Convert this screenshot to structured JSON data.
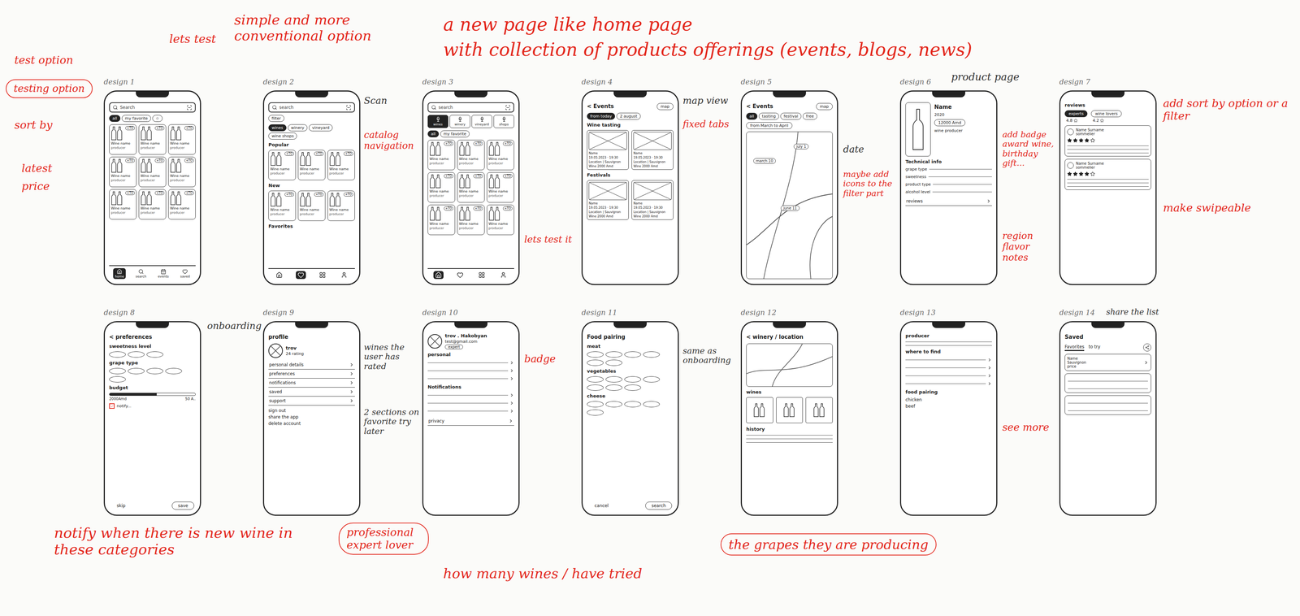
{
  "annotations": [
    {
      "text": "a new page like home page",
      "color": "#e3261b",
      "circled": false
    },
    {
      "text": "with collection of products offerings (events, blogs, news)",
      "color": "#e3261b",
      "circled": false
    },
    {
      "text": "lets test",
      "color": "#e3261b",
      "circled": false
    },
    {
      "text": "simple and more conventional option",
      "color": "#e3261b",
      "circled": false
    },
    {
      "text": "test option",
      "color": "#e3261b",
      "circled": false
    },
    {
      "text": "testing option",
      "color": "#e3261b",
      "circled": true
    },
    {
      "text": "sort by",
      "color": "#e3261b",
      "circled": false
    },
    {
      "text": "latest",
      "color": "#e3261b",
      "circled": false
    },
    {
      "text": "price",
      "color": "#e3261b",
      "circled": false
    },
    {
      "text": "Scan",
      "color": "#333333",
      "circled": false
    },
    {
      "text": "catalog navigation",
      "color": "#e3261b",
      "circled": false
    },
    {
      "text": "lets test it",
      "color": "#e3261b",
      "circled": false
    },
    {
      "text": "map view",
      "color": "#333333",
      "circled": false
    },
    {
      "text": "fixed tabs",
      "color": "#e3261b",
      "circled": false
    },
    {
      "text": "date",
      "color": "#333333",
      "circled": false
    },
    {
      "text": "maybe add icons to the filter part",
      "color": "#e3261b",
      "circled": false
    },
    {
      "text": "product page",
      "color": "#333333",
      "circled": false
    },
    {
      "text": "add badge award wine, birthday gift...",
      "color": "#e3261b",
      "circled": false
    },
    {
      "text": "region flavor notes",
      "color": "#e3261b",
      "circled": false
    },
    {
      "text": "add sort by option or a filter",
      "color": "#e3261b",
      "circled": false
    },
    {
      "text": "make swipeable",
      "color": "#e3261b",
      "circled": false
    },
    {
      "text": "onboarding",
      "color": "#333333",
      "circled": false
    },
    {
      "text": "notify when there is new wine in these categories",
      "color": "#e3261b",
      "circled": false
    },
    {
      "text": "wines the user has rated",
      "color": "#333333",
      "circled": false
    },
    {
      "text": "2 sections on favorite try later",
      "color": "#333333",
      "circled": false
    },
    {
      "text": "badge",
      "color": "#e3261b",
      "circled": false
    },
    {
      "text": "professional expert lover",
      "color": "#e3261b",
      "circled": true
    },
    {
      "text": "how many wines / have tried",
      "color": "#e3261b",
      "circled": false
    },
    {
      "text": "same as onboarding",
      "color": "#333333",
      "circled": false
    },
    {
      "text": "the grapes they are producing",
      "color": "#e3261b",
      "circled": true
    },
    {
      "text": "see more",
      "color": "#e3261b",
      "circled": false
    },
    {
      "text": "share the list",
      "color": "#333333",
      "circled": false
    }
  ],
  "designs": [
    {
      "label": "design 1",
      "screen": [
        {
          "kind": "search",
          "placeholder": "Search"
        },
        {
          "kind": "chips",
          "items": [
            {
              "label": "all",
              "selected": true
            },
            {
              "label": "my favorite",
              "selected": false
            },
            {
              "label": "☆",
              "selected": false
            }
          ]
        },
        {
          "kind": "grid",
          "cards": [
            {
              "badge": "+TO",
              "name": "Wine name",
              "producer": "producer"
            },
            {
              "badge": "+TO",
              "name": "Wine name",
              "producer": "producer"
            },
            {
              "badge": "+TO",
              "name": "Wine name",
              "producer": "producer"
            },
            {
              "badge": "+TO",
              "name": "Wine name",
              "producer": "producer"
            },
            {
              "badge": "+TO",
              "name": "Wine name",
              "producer": "producer"
            },
            {
              "badge": "+TO",
              "name": "Wine name",
              "producer": "producer"
            },
            {
              "badge": "+TO",
              "name": "Wine name",
              "producer": "producer"
            },
            {
              "badge": "+TO",
              "name": "Wine name",
              "producer": "producer"
            },
            {
              "badge": "+TO",
              "name": "Wine name",
              "producer": "producer"
            }
          ]
        },
        {
          "kind": "nav",
          "items": [
            {
              "label": "home",
              "selected": true
            },
            {
              "label": "search",
              "selected": false
            },
            {
              "label": "events",
              "selected": false
            },
            {
              "label": "saved",
              "selected": false
            }
          ]
        }
      ]
    },
    {
      "label": "design 2",
      "screen": [
        {
          "kind": "search",
          "placeholder": "search"
        },
        {
          "kind": "chips",
          "items": [
            {
              "label": "filter",
              "selected": false
            }
          ]
        },
        {
          "kind": "chips",
          "items": [
            {
              "label": "wines",
              "selected": true
            },
            {
              "label": "winery",
              "selected": false
            },
            {
              "label": "vineyard",
              "selected": false
            },
            {
              "label": "wine shops",
              "selected": false
            }
          ]
        },
        {
          "kind": "heading",
          "text": "Popular"
        },
        {
          "kind": "grid",
          "cards": [
            {
              "badge": "+TO",
              "name": "Wine name",
              "producer": "producer"
            },
            {
              "badge": "+TO",
              "name": "Wine name",
              "producer": "producer"
            },
            {
              "badge": "+TO",
              "name": "Wine name",
              "producer": "producer"
            }
          ]
        },
        {
          "kind": "heading",
          "text": "New"
        },
        {
          "kind": "grid",
          "cards": [
            {
              "badge": "+TO",
              "name": "Wine name",
              "producer": "producer"
            },
            {
              "badge": "+TO",
              "name": "Wine name",
              "producer": "producer"
            },
            {
              "badge": "+TO",
              "name": "Wine name",
              "producer": "producer"
            }
          ]
        },
        {
          "kind": "heading",
          "text": "Favorites"
        },
        {
          "kind": "iconnav",
          "items": [
            {
              "selected": false
            },
            {
              "selected": true
            },
            {
              "selected": false
            },
            {
              "selected": false
            }
          ]
        }
      ]
    },
    {
      "label": "design 3",
      "screen": [
        {
          "kind": "search",
          "placeholder": "search"
        },
        {
          "kind": "tiles",
          "items": [
            {
              "label": "wines",
              "selected": true
            },
            {
              "label": "winery",
              "selected": false
            },
            {
              "label": "vineyard",
              "selected": false
            },
            {
              "label": "shops",
              "selected": false
            }
          ]
        },
        {
          "kind": "chips",
          "items": [
            {
              "label": "all",
              "selected": true
            },
            {
              "label": "my favorite",
              "selected": false
            }
          ]
        },
        {
          "kind": "grid",
          "cards": [
            {
              "badge": "+TO",
              "name": "Wine name",
              "producer": "producer"
            },
            {
              "badge": "+TO",
              "name": "Wine name",
              "producer": "producer"
            },
            {
              "badge": "+TO",
              "name": "Wine name",
              "producer": "producer"
            },
            {
              "badge": "+TO",
              "name": "Wine name",
              "producer": "producer"
            },
            {
              "badge": "+TO",
              "name": "Wine name",
              "producer": "producer"
            },
            {
              "badge": "+TO",
              "name": "Wine name",
              "producer": "producer"
            },
            {
              "badge": "+TO",
              "name": "Wine name",
              "producer": "producer"
            },
            {
              "badge": "+TO",
              "name": "Wine name",
              "producer": "producer"
            },
            {
              "badge": "+TO",
              "name": "Wine name",
              "producer": "producer"
            }
          ]
        },
        {
          "kind": "iconnav",
          "items": [
            {
              "selected": true
            },
            {
              "selected": false
            },
            {
              "selected": false
            },
            {
              "selected": false
            }
          ]
        }
      ]
    },
    {
      "label": "design 4",
      "screen": [
        {
          "kind": "titlebar",
          "title": "< Events",
          "action": "map"
        },
        {
          "kind": "chips",
          "items": [
            {
              "label": "from today",
              "selected": true
            },
            {
              "label": "2 august",
              "selected": false
            }
          ]
        },
        {
          "kind": "heading",
          "text": "Wine tasting"
        },
        {
          "kind": "events",
          "items": [
            {
              "lines": [
                "Name",
                "19.05.2023 · 19:30",
                "Location | Sauvignon",
                "Wine 2000 Amd"
              ]
            },
            {
              "lines": [
                "Name",
                "19.05.2023 · 19:30",
                "Location | Sauvignon",
                "Wine 2000 Amd"
              ]
            }
          ]
        },
        {
          "kind": "heading",
          "text": "Festivals"
        },
        {
          "kind": "events",
          "items": [
            {
              "lines": [
                "Name",
                "19.05.2023 · 19:30",
                "Location | Sauvignon",
                "Wine 2000 Amd"
              ]
            },
            {
              "lines": [
                "Name",
                "19.05.2023 · 19:30",
                "Location | Sauvignon",
                "Wine 2000 Amd"
              ]
            }
          ]
        }
      ]
    },
    {
      "label": "design 5",
      "screen": [
        {
          "kind": "titlebar",
          "title": "< Events",
          "action": "map"
        },
        {
          "kind": "chips",
          "items": [
            {
              "label": "all",
              "selected": true
            },
            {
              "label": "tasting",
              "selected": false
            },
            {
              "label": "festival",
              "selected": false
            },
            {
              "label": "free",
              "selected": false
            }
          ]
        },
        {
          "kind": "pill",
          "text": "from March to April"
        },
        {
          "kind": "map",
          "pins": [
            "march 10",
            "july 1",
            "june 11"
          ]
        }
      ]
    },
    {
      "label": "design 6",
      "screen": [
        {
          "kind": "product",
          "name": "Name",
          "year": "2020",
          "price": "12000 Amd",
          "producer": "wine producer"
        },
        {
          "kind": "heading",
          "text": "Technical info"
        },
        {
          "kind": "fields",
          "items": [
            "grape type",
            "sweetness",
            "product type",
            "alcohol level"
          ]
        },
        {
          "kind": "menu",
          "items": [
            "reviews"
          ]
        }
      ]
    },
    {
      "label": "design 7",
      "screen": [
        {
          "kind": "heading",
          "text": "reviews"
        },
        {
          "kind": "segtabs",
          "items": [
            {
              "label": "experts",
              "rating": "4.8",
              "selected": true
            },
            {
              "label": "wine lovers",
              "rating": "4.2",
              "selected": false
            }
          ]
        },
        {
          "kind": "review",
          "name": "Name Surname",
          "role": "sommelier",
          "stars": 4
        },
        {
          "kind": "review",
          "name": "Name Surname",
          "role": "sommelier",
          "stars": 4
        }
      ]
    },
    {
      "label": "design 8",
      "screen": [
        {
          "kind": "title",
          "text": "< preferences"
        },
        {
          "kind": "heading",
          "text": "sweetness level"
        },
        {
          "kind": "ovals",
          "count": 3
        },
        {
          "kind": "heading",
          "text": "grape type"
        },
        {
          "kind": "ovals",
          "count": 5
        },
        {
          "kind": "heading",
          "text": "budget"
        },
        {
          "kind": "slider",
          "level": 0.55,
          "min": "2000Amd",
          "max": "50 A.."
        },
        {
          "kind": "check",
          "label": "notify...",
          "checked": true
        },
        {
          "kind": "buttons",
          "items": [
            {
              "label": "skip",
              "primary": false
            },
            {
              "label": "save",
              "primary": true
            }
          ]
        }
      ]
    },
    {
      "label": "design 9",
      "screen": [
        {
          "kind": "title",
          "text": "profile"
        },
        {
          "kind": "profile",
          "name": "trov",
          "sub": "24 rating",
          "badge": ""
        },
        {
          "kind": "menu",
          "items": [
            "personal details",
            "preferences",
            "notifications",
            "saved",
            "support"
          ]
        },
        {
          "kind": "textlist",
          "items": [
            "sign out",
            "share the app",
            "delete account"
          ]
        }
      ]
    },
    {
      "label": "design 10",
      "screen": [
        {
          "kind": "profile",
          "name": "trov . Hakobyan",
          "sub": "test@gmail.com",
          "badge": "expert"
        },
        {
          "kind": "heading",
          "text": "personal"
        },
        {
          "kind": "lines",
          "count": 3,
          "chevron": true
        },
        {
          "kind": "heading",
          "text": "Notifications"
        },
        {
          "kind": "lines",
          "count": 3,
          "chevron": true
        },
        {
          "kind": "menu",
          "items": [
            "privacy"
          ]
        }
      ]
    },
    {
      "label": "design 11",
      "screen": [
        {
          "kind": "title",
          "text": "Food pairing"
        },
        {
          "kind": "heading",
          "text": "meat"
        },
        {
          "kind": "ovals",
          "count": 6
        },
        {
          "kind": "heading",
          "text": "vegetables"
        },
        {
          "kind": "ovals",
          "count": 7
        },
        {
          "kind": "heading",
          "text": "cheese"
        },
        {
          "kind": "ovals",
          "count": 5
        },
        {
          "kind": "buttons",
          "items": [
            {
              "label": "cancel",
              "primary": false
            },
            {
              "label": "search",
              "primary": true
            }
          ]
        }
      ]
    },
    {
      "label": "design 12",
      "screen": [
        {
          "kind": "title",
          "text": "< winery / location"
        },
        {
          "kind": "mapblock"
        },
        {
          "kind": "heading",
          "text": "wines"
        },
        {
          "kind": "blocks",
          "count": 3
        },
        {
          "kind": "heading",
          "text": "history"
        },
        {
          "kind": "lines",
          "count": 3,
          "chevron": false
        }
      ]
    },
    {
      "label": "design 13",
      "screen": [
        {
          "kind": "heading",
          "text": "producer"
        },
        {
          "kind": "lines",
          "count": 2,
          "chevron": false
        },
        {
          "kind": "heading",
          "text": "where to find"
        },
        {
          "kind": "lines",
          "count": 4,
          "chevron": true
        },
        {
          "kind": "heading",
          "text": "food pairing"
        },
        {
          "kind": "textlist",
          "items": [
            "chicken",
            "beef"
          ]
        }
      ]
    },
    {
      "label": "design 14",
      "screen": [
        {
          "kind": "title",
          "text": "Saved"
        },
        {
          "kind": "savedtabs",
          "items": [
            {
              "label": "Favorites",
              "selected": true
            },
            {
              "label": "to try",
              "selected": false
            }
          ]
        },
        {
          "kind": "savedcard",
          "lines": [
            "Name",
            "Sauvignon",
            "price"
          ]
        },
        {
          "kind": "emptycards",
          "count": 2
        }
      ]
    }
  ]
}
